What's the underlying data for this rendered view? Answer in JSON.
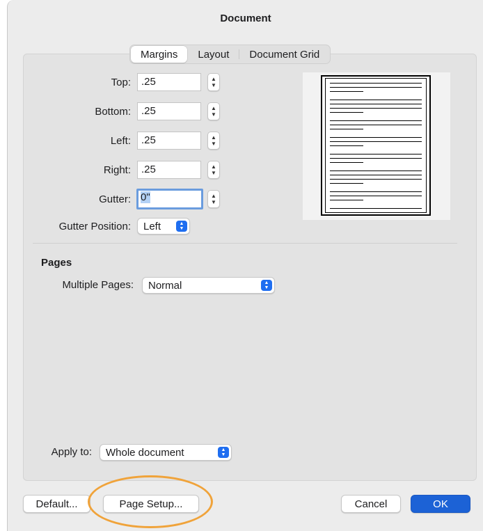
{
  "window": {
    "title": "Document"
  },
  "tabs": [
    {
      "label": "Margins",
      "active": true
    },
    {
      "label": "Layout",
      "active": false
    },
    {
      "label": "Document Grid",
      "active": false
    }
  ],
  "margins": {
    "top": {
      "label": "Top:",
      "value": ".25"
    },
    "bottom": {
      "label": "Bottom:",
      "value": ".25"
    },
    "left": {
      "label": "Left:",
      "value": ".25"
    },
    "right": {
      "label": "Right:",
      "value": ".25"
    },
    "gutter": {
      "label": "Gutter:",
      "value": "0\""
    },
    "gutter_position": {
      "label": "Gutter Position:",
      "value": "Left"
    }
  },
  "pages": {
    "section_title": "Pages",
    "multiple_pages": {
      "label": "Multiple Pages:",
      "value": "Normal"
    }
  },
  "apply_to": {
    "label": "Apply to:",
    "value": "Whole document"
  },
  "buttons": {
    "default": "Default...",
    "page_setup": "Page Setup...",
    "cancel": "Cancel",
    "ok": "OK"
  },
  "colors": {
    "accent": "#1c62d6",
    "highlight": "#f0a33a"
  }
}
